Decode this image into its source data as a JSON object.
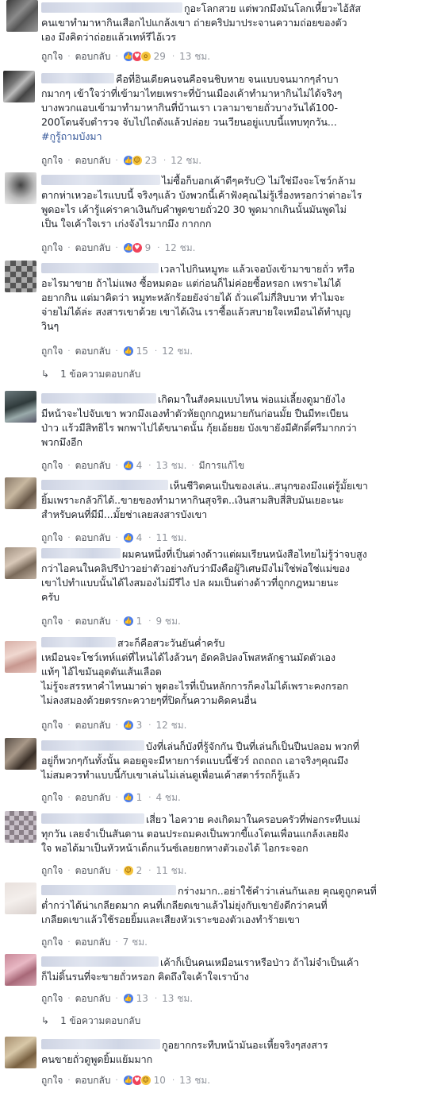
{
  "labels": {
    "like": "ถูกใจ",
    "reply": "ตอบกลับ",
    "edited": "มีการแก้ไข"
  },
  "comments": [
    {
      "lines": [
        "กูอะโลกสวย แต่พวกมึงมันโลกเหี้ยวะไอ้สัส",
        "คนเขาทำมาหากินเสือกไปแกล้งเขา ถ่ายคริปมาประจานความถ่อยของตัว",
        "เอง มึงคิดว่าถ่อยแล้วเทห์รึไอ้เวร"
      ],
      "reactions": [
        "like-icon",
        "love-icon",
        "wow-icon"
      ],
      "count": "29",
      "time": "13 ชม."
    },
    {
      "lines": [
        "คือที่อินเดียคนจนคือจนชิบหาย จนแบบจนมากๆลำบา",
        "กมากๆ เข้าใจว่าที่เข้ามาไทยเพราะที่บ้านเมืองเค้าทำมาหากินไม่ได้จริงๆ",
        "บางพวกแอบเข้ามาทำมาหากินที่บ้านเรา เวลามาขายถั่วบางวันได้100-",
        "200โดนจับตำรวจ จับไปไถตังแล้วปล่อย วนเวียนอยู่แบบนี้แทบทุกวัน..."
      ],
      "hashtag": "#กูรู้ถามบังมา",
      "reactions": [
        "like-icon",
        "haha-icon"
      ],
      "count": "23",
      "time": "12 ชม."
    },
    {
      "lines": [
        "ไม่ซื้อก็บอกเค้าดีๆครับ😏 ไม่ใช่มึงจะโชว์กล้าม",
        "ตากห่าเหวอะไรแบบนี้ จริงๆแล้ว บังพวกนี้เค้าฟังคุณไม่รู้เรื่องหรอกว่าต่าอะไร",
        "พูดอะไร เค้ารู้แค่ราคาเงินกับคำพูดขายถั่ว20 30 พูดมากเกินนั้นมันพูดไม่",
        "เป็น ใจเค้าใจเรา เก่งจังไรมากมึง กากกก"
      ],
      "reactions": [
        "like-icon",
        "love-icon"
      ],
      "count": "9",
      "time": "12 ชม."
    },
    {
      "lines": [
        "เวลาไปกินหมูทะ แล้วเจอบังเข้ามาขายถั่ว หรือ",
        "อะไรมาขาย ถ้าไม่แพง ซื้อหมดอะ แต่ก่อนก็ไม่ค่อยซื้อหรอก เพราะไม่ได้",
        "อยากกิน แต่มาคิดว่า หมูทะหลักร้อยยังจ่ายได้ ถั่วแค่ไม่กี่สิบบาท ทำไมจะ",
        "จ่ายไม่ได้ล่ะ สงสารเขาด้วย เขาได้เงิน เราซื้อแล้วสบายใจเหมือนได้ทำบุญ",
        "วินๆ"
      ],
      "reactions": [
        "like-icon"
      ],
      "count": "15",
      "time": "12 ชม.",
      "replies": "1 ข้อความตอบกลับ"
    },
    {
      "lines": [
        "เกิดมาในสังคมแบบไหน พ่อแม่เลี้ยงดูมายังไง",
        "มีหน้าจะไปจับเขา พวกมึงเองทำตัวห้ยถูกกฎหมายกันก่อนมั้ย ปืนมีทะเบียน",
        "ป่าว แร้วมีสิทธิไร พกพาไปได้ขนาดนั้น กุ้ยเอ้ยยย บังเขายังมีศักดิ์ศรีมากกว่า",
        "พวกมึงอีก"
      ],
      "reactions": [
        "like-icon"
      ],
      "count": "4",
      "time": "13 ชม.",
      "edited": true
    },
    {
      "lines": [
        "เห็นชีวิตคนเป็นของเล่น..สนุกของมึงแต่รู้มั้ยเขา",
        "ยิ้มเพราะกลัวก็ได้..ขายของทำมาหากินสุจริต..เงินสามสิบสี่สิบมันเยอะนะ",
        "สำหรับคนที่มีมี...มั้ยช่าเลยสงสารบังเขา"
      ],
      "reactions": [
        "like-icon"
      ],
      "count": "4",
      "time": "11 ชม."
    },
    {
      "lines": [
        "ผมคนหนึ่งที่เป็นต่างด้าวแต่ผมเรียนหนังสือไทยไม่รู้ว่าจบสูง",
        "กว่าไอคนในคลิปรึป่าวอย่าตัวอย่างกับว่ามึงคือผู้วิเศษมึงไม่ใช่พ่อใช่แม่ของ",
        "เขาไปทำแบบนั้นได้ไงสมองไม่มีรึไง ปล ผมเป็นต่างด้าวที่ถูกกฎหมายนะ",
        "ครับ"
      ],
      "reactions": [
        "like-icon"
      ],
      "count": "1",
      "time": "9 ชม."
    },
    {
      "lines": [
        "สวะก็คือสวะวันยันค่ำครับ",
        "เหมือนจะโชว์เทห์แต่ที่ไหนได้ไงล้วนๆ อัดคลิปลงโพสหลักฐานมัดตัวเอง",
        "แท้ๆ ไอ้ไขมันอุดตันเส้นเลือด",
        "ไม่รู้จะสรรหาคำไหนมาด่า พูดอะไรที่เป็นหลักการก็คงไม่ได้เพราะคงกรอก",
        "ไม่ลงสมองด้วยตรรกะควายๆที่ปิดกั้นความคิดคนอื่น"
      ],
      "reactions": [
        "like-icon"
      ],
      "count": "3",
      "time": "12 ชม."
    },
    {
      "lines": [
        "บังที่เล่นก็บังที่รู้จักกัน ปืนที่เล่นก็เป็นปืนปลอม พวกที่",
        "อยู่ก็พวกๆกันทั้งนั้น คอยดูจะมีหายการ์ดแบบนี้ชัวร์ ถถถถถ เอาจริงๆคุณมึง",
        "ไม่สมควรทำแบบนี้กับเขาเล่นไม่เล่นดูเพื่อนเค้าสตาร์รถก็รู้แล้ว"
      ],
      "reactions": [
        "like-icon"
      ],
      "count": "1",
      "time": "4 ชม."
    },
    {
      "lines": [
        "เสี่ยว ไอควาย คงเกิดมาในครอบครัวที่พ่อกระทืบแม่",
        "ทุกวัน เลยจำเป็นสันดาน ตอนประถมคงเป็นพวกขี้แงโดนเพื่อนแกล้งเลยฝัง",
        "ใจ พอได้มาเป็นหัวหน้าเด็กแว้นซ์เลยยกหางตัวเองได้ ไอกระจอก"
      ],
      "reactions": [
        "haha-icon"
      ],
      "count": "2",
      "time": "11 ชม."
    },
    {
      "lines": [
        "กร่างมาก..อย่าใช้คำว่าเล่นกันเลย คุณดูถูกคนที่",
        "ต่ำกว่าได้น่าเกลียดมาก คนที่เกลียดเขาแล้วไม่ยุ่งกับเขายังดีกว่าคนที่",
        "เกลียดเขาแล้วใช้รอยยิ้มและเสียงหัวเราะของตัวเองทำร้ายเขา"
      ],
      "reactions": [],
      "count": "",
      "time": "7 ชม."
    },
    {
      "lines": [
        "เค้าก็เป็นคนเหมือนเราหรือป่าว ถ้าไม่จำเป็นเค้า",
        "ก็ไม่ดิ้นรนที่จะขายถั่วหรอก คิดถึงใจเค้าใจเราบ้าง"
      ],
      "reactions": [
        "like-icon"
      ],
      "count": "13",
      "time": "13 ชม.",
      "replies": "1 ข้อความตอบกลับ"
    },
    {
      "lines": [
        "กูอยากกระทืบหน้ามันอะเหี้ยจริงๆสงสาร",
        "คนขายถั่วดูพูดยิ้มแย้มมาก"
      ],
      "reactions": [
        "like-icon",
        "love-icon",
        "haha-icon"
      ],
      "count": "10",
      "time": "13 ชม."
    }
  ]
}
